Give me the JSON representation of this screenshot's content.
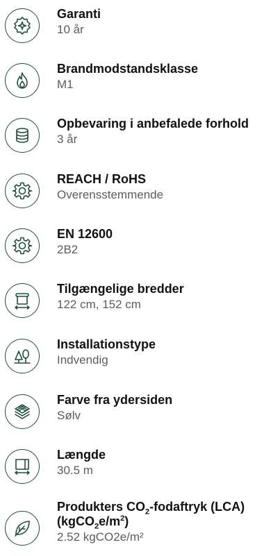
{
  "specs": [
    {
      "icon": "warranty-badge-icon",
      "label": "Garanti",
      "value": "10 år"
    },
    {
      "icon": "flame-icon",
      "label": "Brandmodstandsklasse",
      "value": "M1"
    },
    {
      "icon": "storage-database-icon",
      "label": "Opbevaring i anbefalede forhold",
      "value": "3 år"
    },
    {
      "icon": "gear-icon",
      "label": "REACH / RoHS",
      "value": "Overensstemmende"
    },
    {
      "icon": "gear-icon",
      "label": "EN 12600",
      "value": "2B2"
    },
    {
      "icon": "roll-width-icon",
      "label": "Tilgængelige bredder",
      "value": "122 cm, 152 cm"
    },
    {
      "icon": "installation-tree-icon",
      "label": "Installationstype",
      "value": "Indvendig"
    },
    {
      "icon": "layers-icon",
      "label": "Farve fra ydersiden",
      "value": "Sølv"
    },
    {
      "icon": "length-icon",
      "label": "Længde",
      "value": "30.5 m"
    },
    {
      "icon": "leaf-icon",
      "label_parts": {
        "pre": "Produkters CO",
        "sub1": "2",
        "mid": "-fodaftryk (LCA)",
        "line2_pre": "(kgCO",
        "sub2": "2",
        "line2_mid": "e/m",
        "sup": "2",
        "line2_post": ")"
      },
      "value": "2.52 kgCO2e/m²"
    }
  ],
  "colors": {
    "icon_stroke": "#1e4e3c",
    "label": "#111111",
    "value": "#5c5c5c"
  }
}
